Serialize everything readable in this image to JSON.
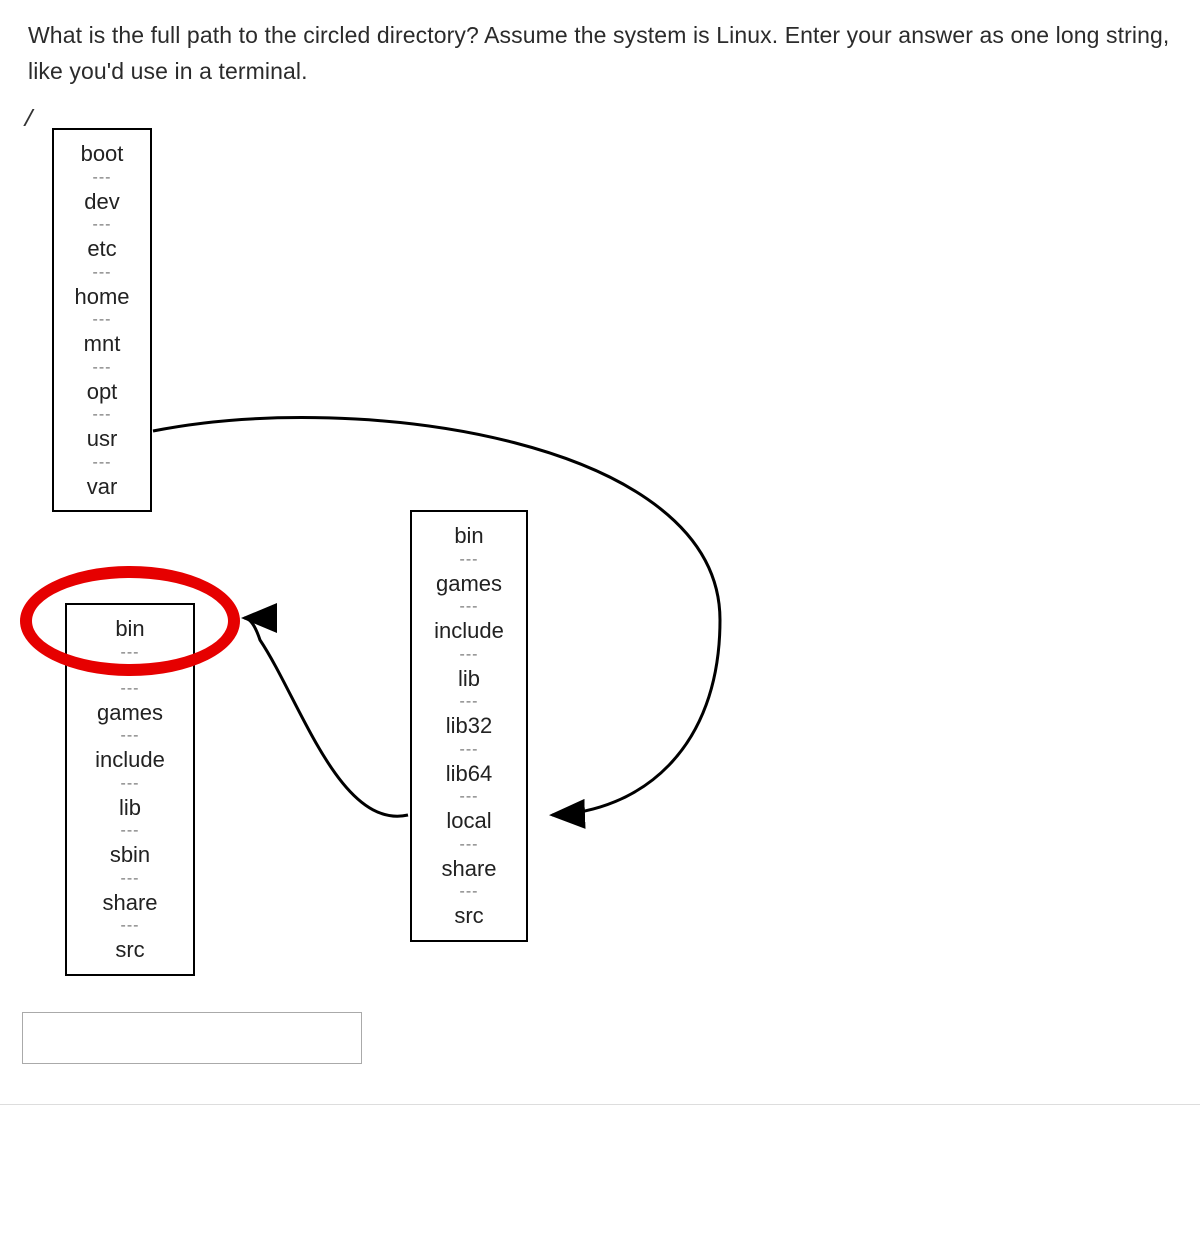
{
  "question_text": "What is the full path to the circled directory? Assume the system is Linux. Enter your answer as one long string, like you'd use in a terminal.",
  "root_label": "/",
  "separator": "---",
  "box_root": {
    "items": [
      "boot",
      "dev",
      "etc",
      "home",
      "mnt",
      "opt",
      "usr",
      "var"
    ]
  },
  "box_usr": {
    "items": [
      "bin",
      "games",
      "include",
      "lib",
      "lib32",
      "lib64",
      "local",
      "share",
      "src"
    ]
  },
  "box_local": {
    "items": [
      "bin",
      "",
      "games",
      "include",
      "lib",
      "sbin",
      "share",
      "src"
    ]
  },
  "circled_item": "bin",
  "answer_value": ""
}
